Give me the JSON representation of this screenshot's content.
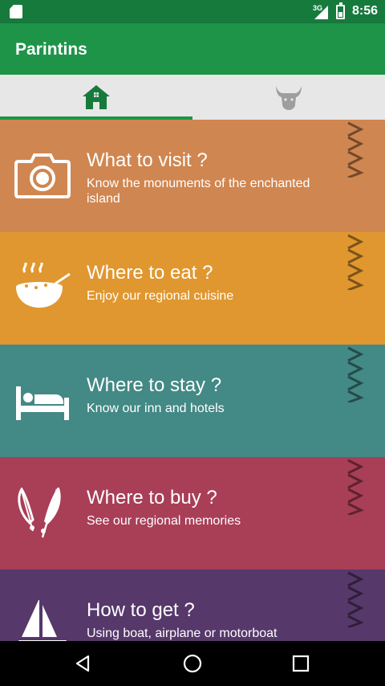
{
  "status_bar": {
    "network": "3G",
    "time": "8:56"
  },
  "app_bar": {
    "title": "Parintins"
  },
  "tabs": [
    {
      "icon": "home-icon",
      "selected": true
    },
    {
      "icon": "boi-bull-icon",
      "selected": false
    }
  ],
  "colors": {
    "status_bar": "#167a3c",
    "app_bar": "#1e9449",
    "tab_bar": "#e7e7e7",
    "selected_tab_icon": "#167a3c",
    "unselected_tab_icon": "#9e9e9e"
  },
  "cards": [
    {
      "title": "What to visit ?",
      "subtitle": "Know the monuments of the enchanted island",
      "icon": "camera-icon",
      "color": "#d08650"
    },
    {
      "title": "Where to eat ?",
      "subtitle": "Enjoy our regional cuisine",
      "icon": "soup-bowl-icon",
      "color": "#e0972f"
    },
    {
      "title": "Where to stay ?",
      "subtitle": "Know our inn and hotels",
      "icon": "bed-icon",
      "color": "#438985"
    },
    {
      "title": "Where to buy ?",
      "subtitle": "See our regional memories",
      "icon": "feathers-icon",
      "color": "#a93e57"
    },
    {
      "title": "How to get ?",
      "subtitle": "Using boat, airplane or motorboat",
      "icon": "sailboat-icon",
      "color": "#56386a"
    }
  ],
  "nav_bar": {
    "buttons": [
      "back-icon",
      "home-circle-icon",
      "recents-icon"
    ]
  }
}
